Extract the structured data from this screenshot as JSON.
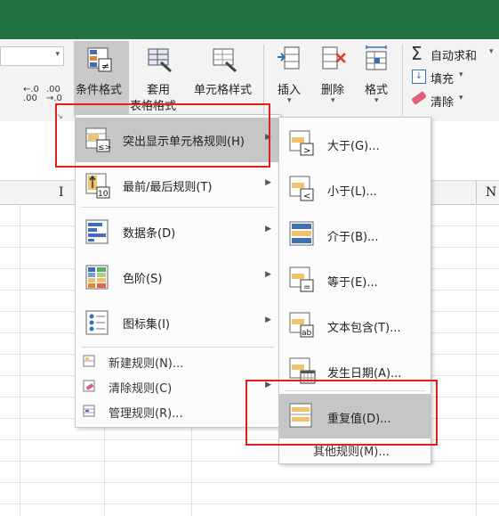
{
  "ribbon": {
    "decimal_increase": ".00\n→.0",
    "decimal_decrease": "←.0\n.00",
    "cond_format": "条件格式",
    "table_format_line1": "套用",
    "table_format_line2": "表格格式",
    "cell_style": "单元格样式",
    "insert": "插入",
    "delete": "删除",
    "format": "格式",
    "autosum": "自动求和",
    "fill": "填充",
    "clear": "清除"
  },
  "sheet": {
    "col_I": "I",
    "col_N": "N"
  },
  "menu": {
    "highlight_rules": "突出显示单元格规则(H)",
    "top_bottom": "最前/最后规则(T)",
    "data_bars": "数据条(D)",
    "color_scales": "色阶(S)",
    "icon_sets": "图标集(I)",
    "new_rule": "新建规则(N)...",
    "clear_rules": "清除规则(C)",
    "manage_rules": "管理规则(R)..."
  },
  "submenu": {
    "greater": "大于(G)...",
    "less": "小于(L)...",
    "between": "介于(B)...",
    "equal": "等于(E)...",
    "text_contains": "文本包含(T)...",
    "date_occurring": "发生日期(A)...",
    "duplicate": "重复值(D)...",
    "more_rules": "其他规则(M)..."
  },
  "colors": {
    "title_green": "#217346",
    "highlight_red": "#e02020",
    "menu_highlight": "#c6c6c6"
  }
}
